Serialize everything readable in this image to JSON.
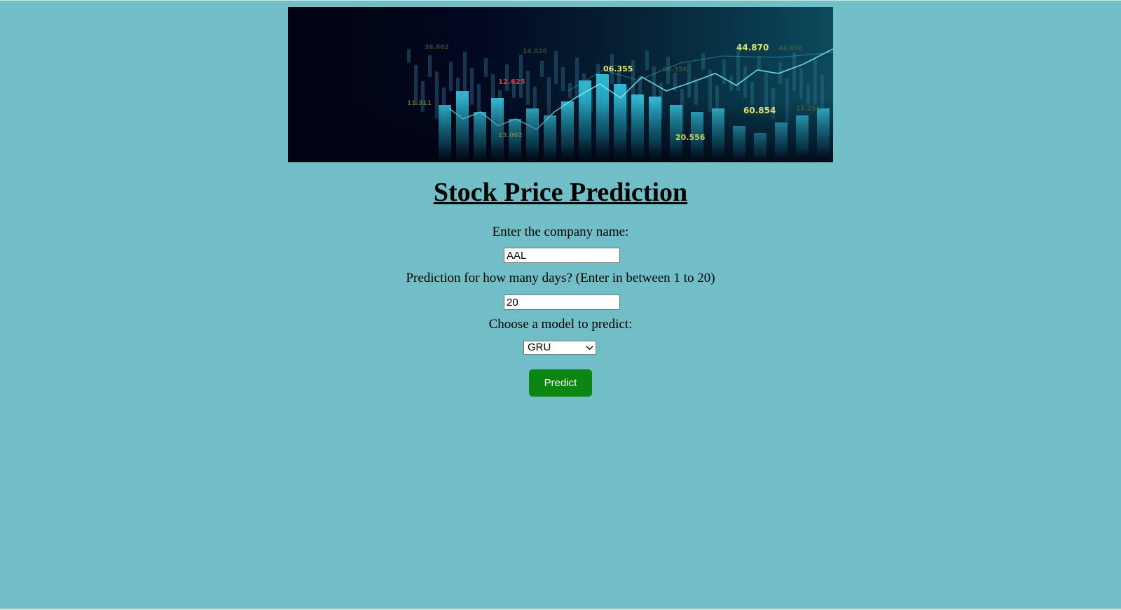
{
  "banner": {
    "description_icon": "stock-chart-banner",
    "tickers": [
      "44.870",
      "06.355",
      "12.625",
      "60.854",
      "20.556",
      "13.002",
      "11.311",
      "38.862",
      "14.020",
      "44.870",
      "06.356",
      "12.256"
    ]
  },
  "page": {
    "title": "Stock Price Prediction"
  },
  "form": {
    "company_label": "Enter the company name:",
    "company_value": "AAL",
    "days_label": "Prediction for how many days? (Enter in between 1 to 20)",
    "days_value": "20",
    "model_label": "Choose a model to predict:",
    "model_selected": "GRU",
    "predict_label": "Predict"
  },
  "colors": {
    "background": "#72bec6",
    "button": "#0d8511"
  }
}
